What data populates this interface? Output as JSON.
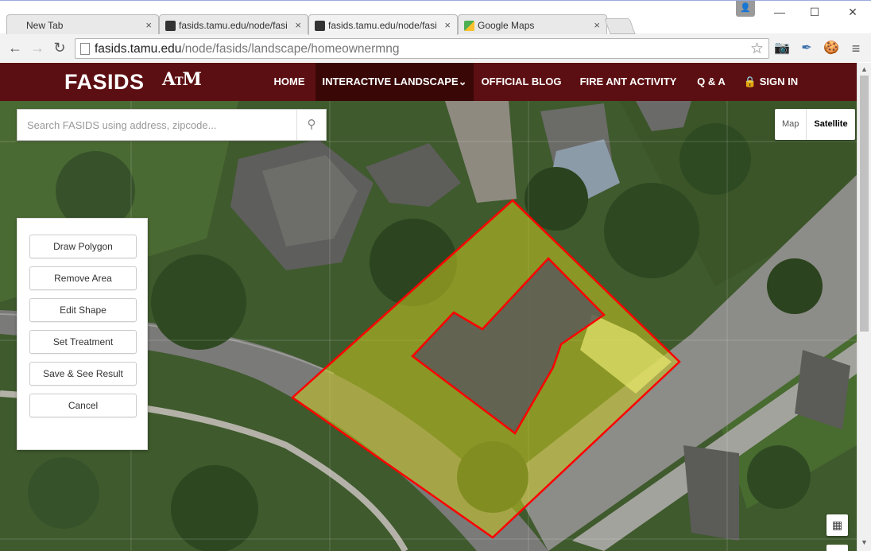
{
  "browser": {
    "tabs": [
      {
        "title": "New Tab",
        "favicon_color": "#ffffff"
      },
      {
        "title": "fasids.tamu.edu/node/fasi",
        "favicon_color": "#333333"
      },
      {
        "title": "fasids.tamu.edu/node/fasi",
        "favicon_color": "#333333"
      },
      {
        "title": "Google Maps",
        "favicon_color": "#4caf50"
      }
    ],
    "close_glyph": "×",
    "url_host": "fasids.tamu.edu",
    "url_path": "/node/fasids/landscape/homeownermng",
    "back_icon": "←",
    "forward_icon": "→",
    "reload_icon": "↻",
    "star_icon": "☆",
    "minimize": "—",
    "maximize": "☐",
    "close": "✕"
  },
  "site": {
    "logo": "FASIDS",
    "atm_logo": "ĀTM",
    "brand_color": "#5c0f12",
    "nav": [
      {
        "label": "HOME"
      },
      {
        "label": "INTERACTIVE LANDSCAPE⌄"
      },
      {
        "label": "OFFICIAL BLOG"
      },
      {
        "label": "FIRE ANT ACTIVITY"
      },
      {
        "label": "Q & A"
      },
      {
        "label": "🔒 SIGN IN"
      }
    ]
  },
  "map": {
    "search_placeholder": "Search FASIDS using address, zipcode...",
    "search_icon": "⚲",
    "map_type": {
      "map": "Map",
      "satellite": "Satellite",
      "selected": "Satellite"
    },
    "polygon_fill": "#c8c820",
    "polygon_stroke": "#ff0000",
    "tools": [
      {
        "label": "Draw Polygon"
      },
      {
        "label": "Remove Area"
      },
      {
        "label": "Edit Shape"
      },
      {
        "label": "Set Treatment"
      },
      {
        "label": "Save & See Result"
      },
      {
        "label": "Cancel"
      }
    ],
    "fullscreen_icon": "▦"
  }
}
